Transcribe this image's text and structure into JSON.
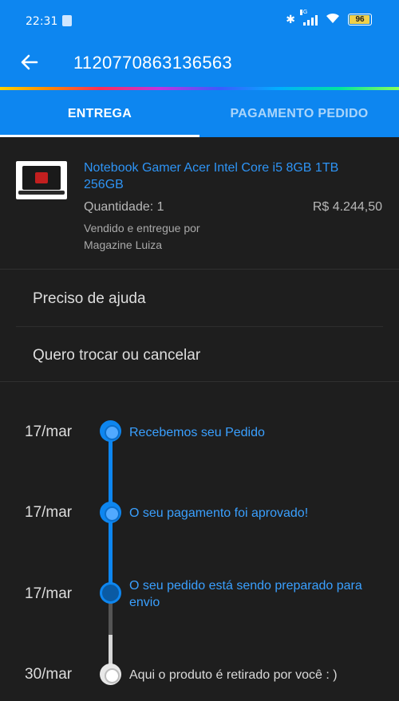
{
  "status_bar": {
    "time": "22:31",
    "network": "4G",
    "battery": "96"
  },
  "header": {
    "title": "1120770863136563"
  },
  "tabs": [
    {
      "label": "ENTREGA",
      "active": true
    },
    {
      "label": "PAGAMENTO PEDIDO",
      "active": false
    }
  ],
  "product": {
    "name": "Notebook Gamer Acer Intel Core i5 8GB 1TB 256GB",
    "quantity": "Quantidade: 1",
    "price": "R$ 4.244,50",
    "sold_by": "Vendido e entregue por",
    "seller": "Magazine Luiza"
  },
  "menu": [
    {
      "label": "Preciso de ajuda"
    },
    {
      "label": "Quero trocar ou cancelar"
    }
  ],
  "timeline": [
    {
      "date": "17/mar",
      "text": "Recebemos seu Pedido",
      "state": "done"
    },
    {
      "date": "17/mar",
      "text": "O seu pagamento foi aprovado!",
      "state": "done"
    },
    {
      "date": "17/mar",
      "text": "O seu pedido está sendo preparado para envio",
      "state": "current"
    },
    {
      "date": "30/mar",
      "text": "Aqui o produto é retirado por você : )",
      "state": "pending"
    }
  ],
  "colors": {
    "primary": "#0d86f0",
    "background": "#1e1e1e",
    "link": "#2e94f5"
  }
}
